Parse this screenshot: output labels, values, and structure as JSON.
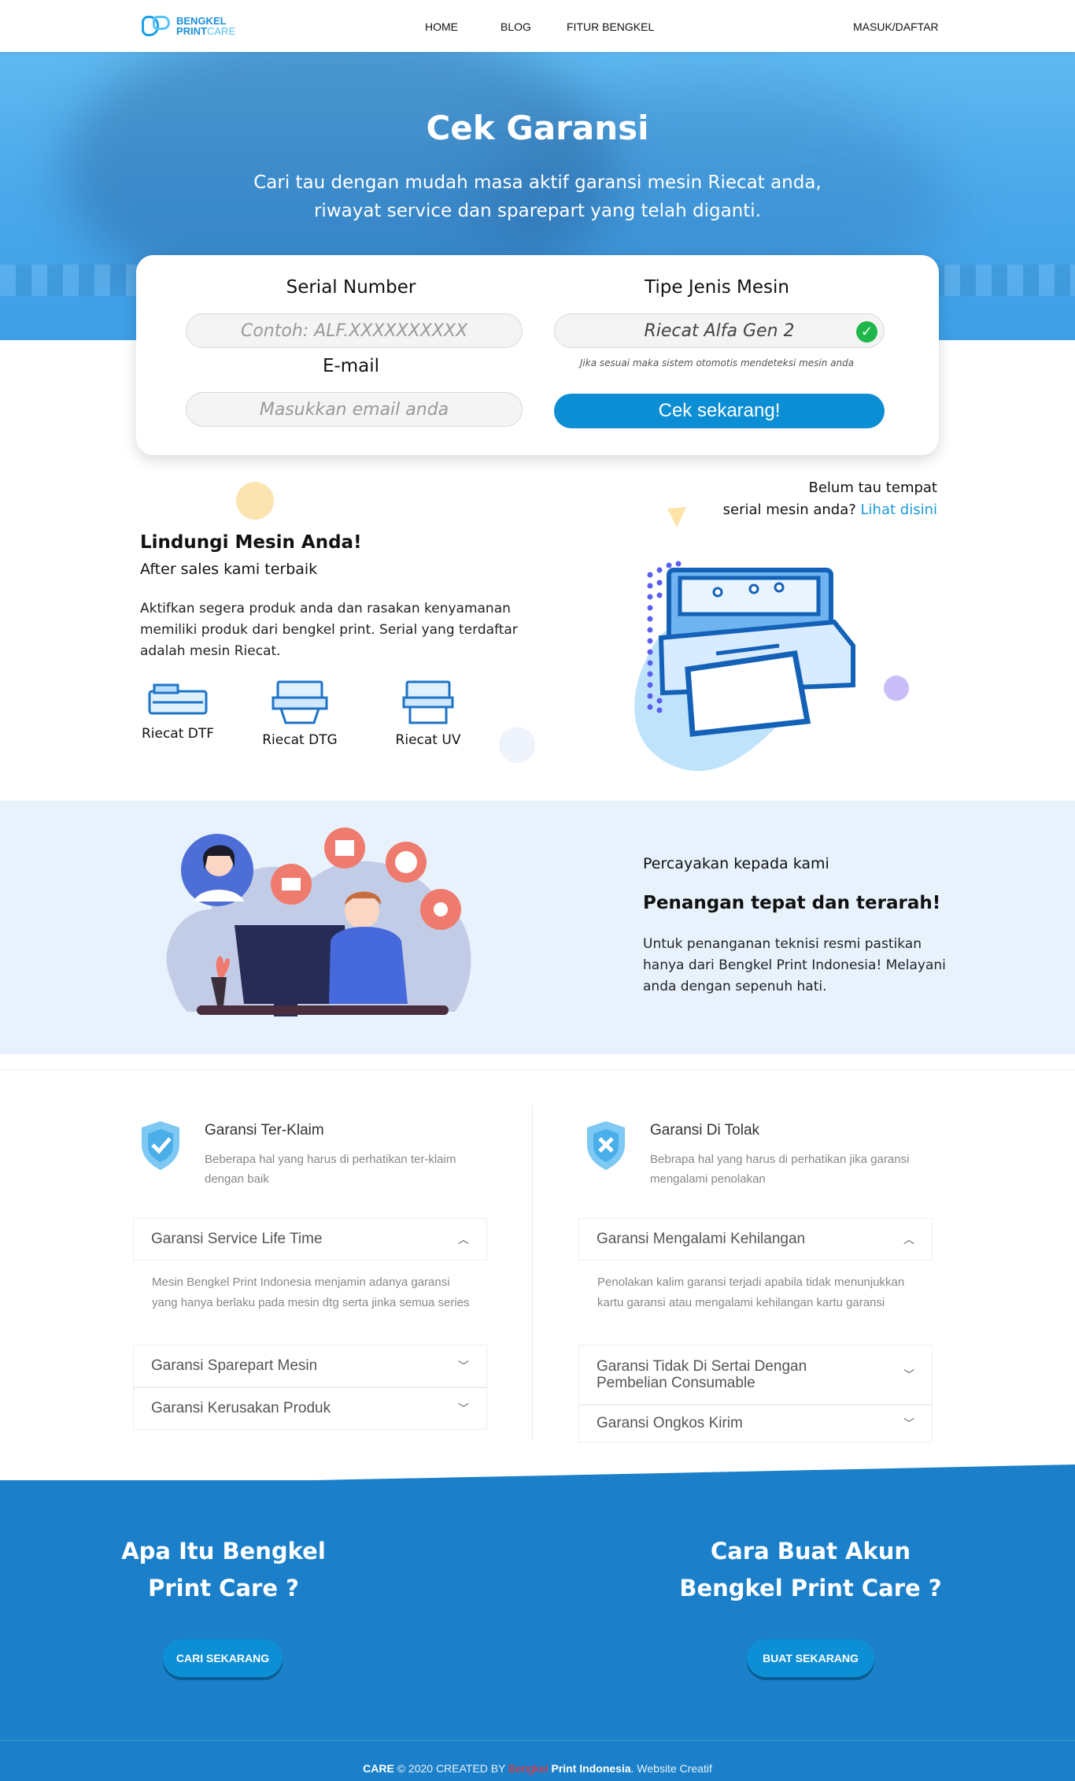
{
  "nav": {
    "logo_line1": "BENGKEL",
    "logo_line2a": "PRINT",
    "logo_line2b": "CARE",
    "links": [
      "HOME",
      "BLOG",
      "FITUR BENGKEL"
    ],
    "login": "MASUK/DAFTAR"
  },
  "hero": {
    "title": "Cek Garansi",
    "subtitle": "Cari tau dengan mudah masa aktif garansi mesin Riecat anda, riwayat service dan sparepart yang telah diganti."
  },
  "form": {
    "serial_label": "Serial Number",
    "serial_placeholder": "Contoh: ALF.XXXXXXXXXX",
    "email_label": "E-mail",
    "email_placeholder": "Masukkan email anda",
    "type_label": "Tipe Jenis Mesin",
    "type_value": "Riecat  Alfa Gen 2",
    "type_hint": "Jika sesuai maka sistem otomotis mendeteksi mesin anda",
    "submit": "Cek sekarang!"
  },
  "protect": {
    "title": "Lindungi Mesin Anda!",
    "subtitle": "After sales kami terbaik",
    "desc": "Aktifkan segera produk anda dan rasakan kenyamanan memiliki produk dari bengkel print. Serial yang terdaftar adalah mesin Riecat.",
    "machines": [
      "Riecat DTF",
      "Riecat DTG",
      "Riecat UV"
    ],
    "find_serial_1": "Belum tau tempat",
    "find_serial_2": "serial mesin anda?",
    "find_serial_link": "Lihat disini"
  },
  "trust": {
    "kicker": "Percayakan kepada kami",
    "title": "Penangan tepat dan terarah!",
    "desc": "Untuk penanganan teknisi resmi pastikan hanya dari Bengkel Print Indonesia! Melayani anda dengan sepenuh hati."
  },
  "claimed": {
    "title": "Garansi Ter-Klaim",
    "desc": "Beberapa hal yang harus di perhatikan ter-klaim dengan baik",
    "items": [
      {
        "label": "Garansi Service Life Time",
        "body": "Mesin Bengkel Print Indonesia menjamin adanya garansi yang hanya berlaku pada mesin dtg serta jinka semua series"
      },
      {
        "label": "Garansi Sparepart Mesin"
      },
      {
        "label": "Garansi Kerusakan Produk"
      }
    ]
  },
  "rejected": {
    "title": "Garansi Di Tolak",
    "desc": "Bebrapa hal yang harus di perhatikan jika garansi mengalami penolakan",
    "items": [
      {
        "label": "Garansi Mengalami Kehilangan",
        "body": "Penolakan kalim garansi terjadi apabila tidak menunjukkan kartu garansi atau mengalami kehilangan kartu garansi"
      },
      {
        "label": "Garansi Tidak Di Sertai Dengan Pembelian Consumable"
      },
      {
        "label": "Garansi Ongkos Kirim"
      }
    ]
  },
  "cta": {
    "left_title_1": "Apa Itu Bengkel",
    "left_title_2": "Print Care ?",
    "left_btn": "CARI SEKARANG",
    "right_title_1": "Cara Buat Akun",
    "right_title_2": "Bengkel Print Care ?",
    "right_btn": "BUAT SEKARANG"
  },
  "footer": {
    "brand": "CARE",
    "copy": "© 2020 CREATED BY",
    "company_red": "Bengkel",
    "company": "Print Indonesia",
    "suffix": ". Website Creatif"
  },
  "colors": {
    "primary": "#0b8ed4",
    "dark_blue": "#1b80c9",
    "light_bg": "#e7f2fd",
    "success": "#1fb74a"
  }
}
